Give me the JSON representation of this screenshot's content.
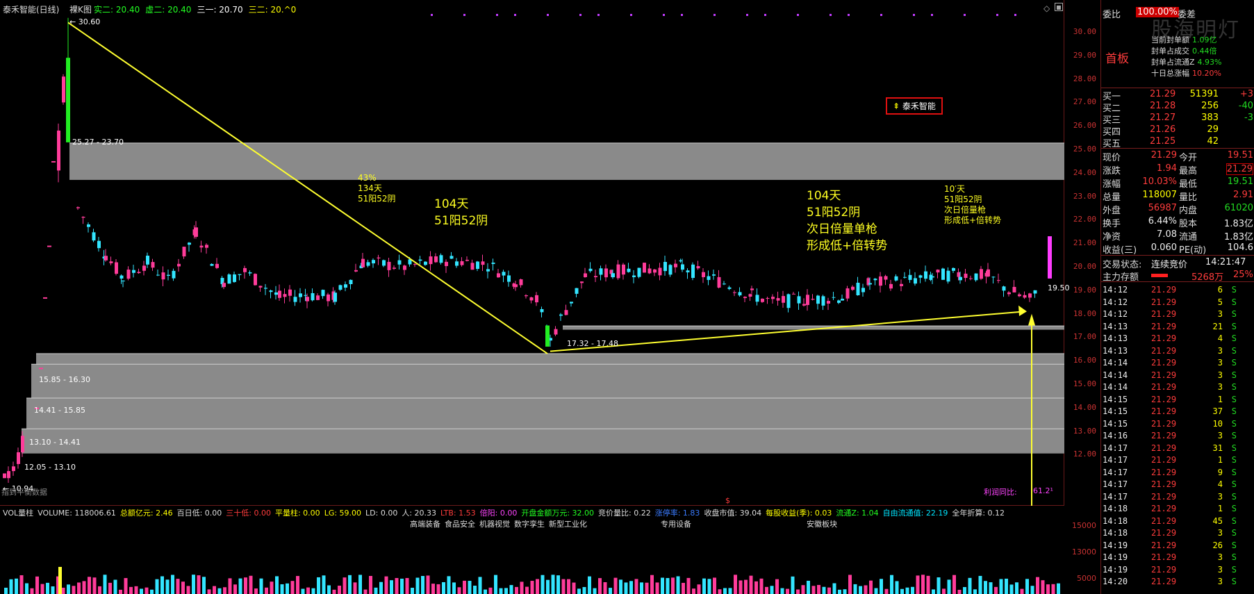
{
  "stock": {
    "name": "泰禾智能(日线)",
    "chart_mode": "裸K图"
  },
  "ma_legend": [
    {
      "label": "实二: 20.40",
      "color": "#22ff22"
    },
    {
      "label": "虚二: 20.40",
      "color": "#22ff22"
    },
    {
      "label": "三一: 20.70",
      "color": "#ffffff"
    },
    {
      "label": "三二: 20.^0",
      "color": "#ffff00"
    }
  ],
  "price_axis": [
    "30.00",
    "29.00",
    "28.00",
    "27.00",
    "26.00",
    "25.00",
    "24.00",
    "23.00",
    "22.00",
    "21.00",
    "20.00",
    "19.00",
    "18.00",
    "17.00",
    "16.00",
    "15.00",
    "14.00",
    "13.00",
    "12.00"
  ],
  "chart_labels": {
    "high": "30.60",
    "low": "10.94",
    "last": "19.50",
    "zone1": "25.27 - 23.70",
    "zone2": "17.32 - 17.48",
    "zone3": "15.85 - 16.30",
    "zone4": "14.41 - 15.85",
    "zone5": "13.10 - 14.41",
    "zone6": "12.05 - 13.10",
    "note1": [
      "43%",
      "134天",
      "51阳52阴"
    ],
    "note2": [
      "104天",
      "51阳52阴"
    ],
    "note3": [
      "104天",
      "51阳52阴",
      "次日倍量单枪",
      "形成低+倍转势"
    ],
    "note4": [
      "10′天",
      "51阳52阴",
      "次日倍量枪",
      "形成低+倍转势"
    ],
    "tag": "泰禾智能",
    "watermark": "股海明灯",
    "bottom_left": "指到平衡数据",
    "bottom_right_label": "利润同比:",
    "bottom_right_value": "61.2¹",
    "marker": "$"
  },
  "vol_header": [
    {
      "label": "VOL量柱",
      "color": "#dddddd"
    },
    {
      "label": "VOLUME: 118006.61",
      "color": "#dddddd"
    },
    {
      "label": "总额亿元: 2.46",
      "color": "#ffff00"
    },
    {
      "label": "百日低: 0.00",
      "color": "#dddddd"
    },
    {
      "label": "三十低: 0.00",
      "color": "#ff3c3c"
    },
    {
      "label": "平量柱: 0.00",
      "color": "#ffff00"
    },
    {
      "label": "LG: 59.00",
      "color": "#ffff00"
    },
    {
      "label": "LD: 0.00",
      "color": "#dddddd"
    },
    {
      "label": "人: 20.33",
      "color": "#dddddd"
    },
    {
      "label": "LTB: 1.53",
      "color": "#ff3c3c"
    },
    {
      "label": "倍阳: 0.00",
      "color": "#ff44ff"
    },
    {
      "label": "开盘金额万元: 32.00",
      "color": "#22ff22"
    },
    {
      "label": "竞价量比: 0.22",
      "color": "#dddddd"
    },
    {
      "label": "涨停率: 1.83",
      "color": "#3a7bff"
    },
    {
      "label": "收盘市值: 39.04",
      "color": "#dddddd"
    },
    {
      "label": "每股收益(季): 0.03",
      "color": "#ffff00"
    },
    {
      "label": "流通Z: 1.04",
      "color": "#22ff22"
    },
    {
      "label": "自由流通值: 22.19",
      "color": "#00e5ff"
    },
    {
      "label": "全年折算: 0.12",
      "color": "#dddddd"
    }
  ],
  "concepts": [
    "高端装备",
    "食品安全",
    "机器视觉",
    "数字孪生",
    "新型工业化",
    "专用设备",
    "安徽板块"
  ],
  "vol_axis": [
    "15000",
    "13000",
    "5000"
  ],
  "quote": {
    "weibi_label": "委比",
    "weibi_value": "100.00%",
    "weicha_label": "委差",
    "board": "首板",
    "seal_lines": [
      {
        "label": "当前封单额",
        "value": "1.09亿"
      },
      {
        "label": "封单占成交",
        "value": "0.44倍"
      },
      {
        "label": "封单占流通Z",
        "value": "4.93%"
      },
      {
        "label": "十日总涨幅",
        "value": "10.20%"
      }
    ],
    "bids": [
      {
        "label": "买一",
        "price": "21.29",
        "vol": "51391",
        "chg": "+3"
      },
      {
        "label": "买二",
        "price": "21.28",
        "vol": "256",
        "chg": "-40"
      },
      {
        "label": "买三",
        "price": "21.27",
        "vol": "383",
        "chg": "-3"
      },
      {
        "label": "买四",
        "price": "21.26",
        "vol": "29",
        "chg": ""
      },
      {
        "label": "买五",
        "price": "21.25",
        "vol": "42",
        "chg": ""
      }
    ],
    "stats": [
      {
        "l1": "现价",
        "v1": "21.29",
        "l2": "今开",
        "v2": "19.51"
      },
      {
        "l1": "涨跌",
        "v1": "1.94",
        "l2": "最高",
        "v2": "21.29"
      },
      {
        "l1": "涨幅",
        "v1": "10.03%",
        "l2": "最低",
        "v2": "19.51"
      },
      {
        "l1": "总量",
        "v1": "118007",
        "l2": "量比",
        "v2": "2.91"
      },
      {
        "l1": "外盘",
        "v1": "56987",
        "l2": "内盘",
        "v2": "61020"
      },
      {
        "l1": "换手",
        "v1": "6.44%",
        "l2": "股本",
        "v2": "1.83亿"
      },
      {
        "l1": "净资",
        "v1": "7.08",
        "l2": "流通",
        "v2": "1.83亿"
      },
      {
        "l1": "收益(三)",
        "v1": "0.060",
        "l2": "PE(动)",
        "v2": "104.6"
      }
    ],
    "trade_state_label": "交易状态:",
    "trade_state": "连续竞价",
    "trade_time": "14:21:47",
    "main_label": "主力存额",
    "main_value": "5268万",
    "main_pct": "25%"
  },
  "ticks": [
    {
      "t": "14:12",
      "p": "21.29",
      "v": "6",
      "d": "S"
    },
    {
      "t": "14:12",
      "p": "21.29",
      "v": "5",
      "d": "S"
    },
    {
      "t": "14:12",
      "p": "21.29",
      "v": "3",
      "d": "S"
    },
    {
      "t": "14:13",
      "p": "21.29",
      "v": "21",
      "d": "S"
    },
    {
      "t": "14:13",
      "p": "21.29",
      "v": "4",
      "d": "S"
    },
    {
      "t": "14:13",
      "p": "21.29",
      "v": "3",
      "d": "S"
    },
    {
      "t": "14:14",
      "p": "21.29",
      "v": "3",
      "d": "S"
    },
    {
      "t": "14:14",
      "p": "21.29",
      "v": "3",
      "d": "S"
    },
    {
      "t": "14:14",
      "p": "21.29",
      "v": "3",
      "d": "S"
    },
    {
      "t": "14:15",
      "p": "21.29",
      "v": "1",
      "d": "S"
    },
    {
      "t": "14:15",
      "p": "21.29",
      "v": "37",
      "d": "S"
    },
    {
      "t": "14:15",
      "p": "21.29",
      "v": "10",
      "d": "S"
    },
    {
      "t": "14:16",
      "p": "21.29",
      "v": "3",
      "d": "S"
    },
    {
      "t": "14:17",
      "p": "21.29",
      "v": "31",
      "d": "S"
    },
    {
      "t": "14:17",
      "p": "21.29",
      "v": "1",
      "d": "S"
    },
    {
      "t": "14:17",
      "p": "21.29",
      "v": "9",
      "d": "S"
    },
    {
      "t": "14:17",
      "p": "21.29",
      "v": "4",
      "d": "S"
    },
    {
      "t": "14:17",
      "p": "21.29",
      "v": "3",
      "d": "S"
    },
    {
      "t": "14:18",
      "p": "21.29",
      "v": "1",
      "d": "S"
    },
    {
      "t": "14:18",
      "p": "21.29",
      "v": "45",
      "d": "S"
    },
    {
      "t": "14:18",
      "p": "21.29",
      "v": "3",
      "d": "S"
    },
    {
      "t": "14:19",
      "p": "21.29",
      "v": "26",
      "d": "S"
    },
    {
      "t": "14:19",
      "p": "21.29",
      "v": "3",
      "d": "S"
    },
    {
      "t": "14:19",
      "p": "21.29",
      "v": "3",
      "d": "S"
    },
    {
      "t": "14:20",
      "p": "21.29",
      "v": "3",
      "d": "S"
    }
  ]
}
